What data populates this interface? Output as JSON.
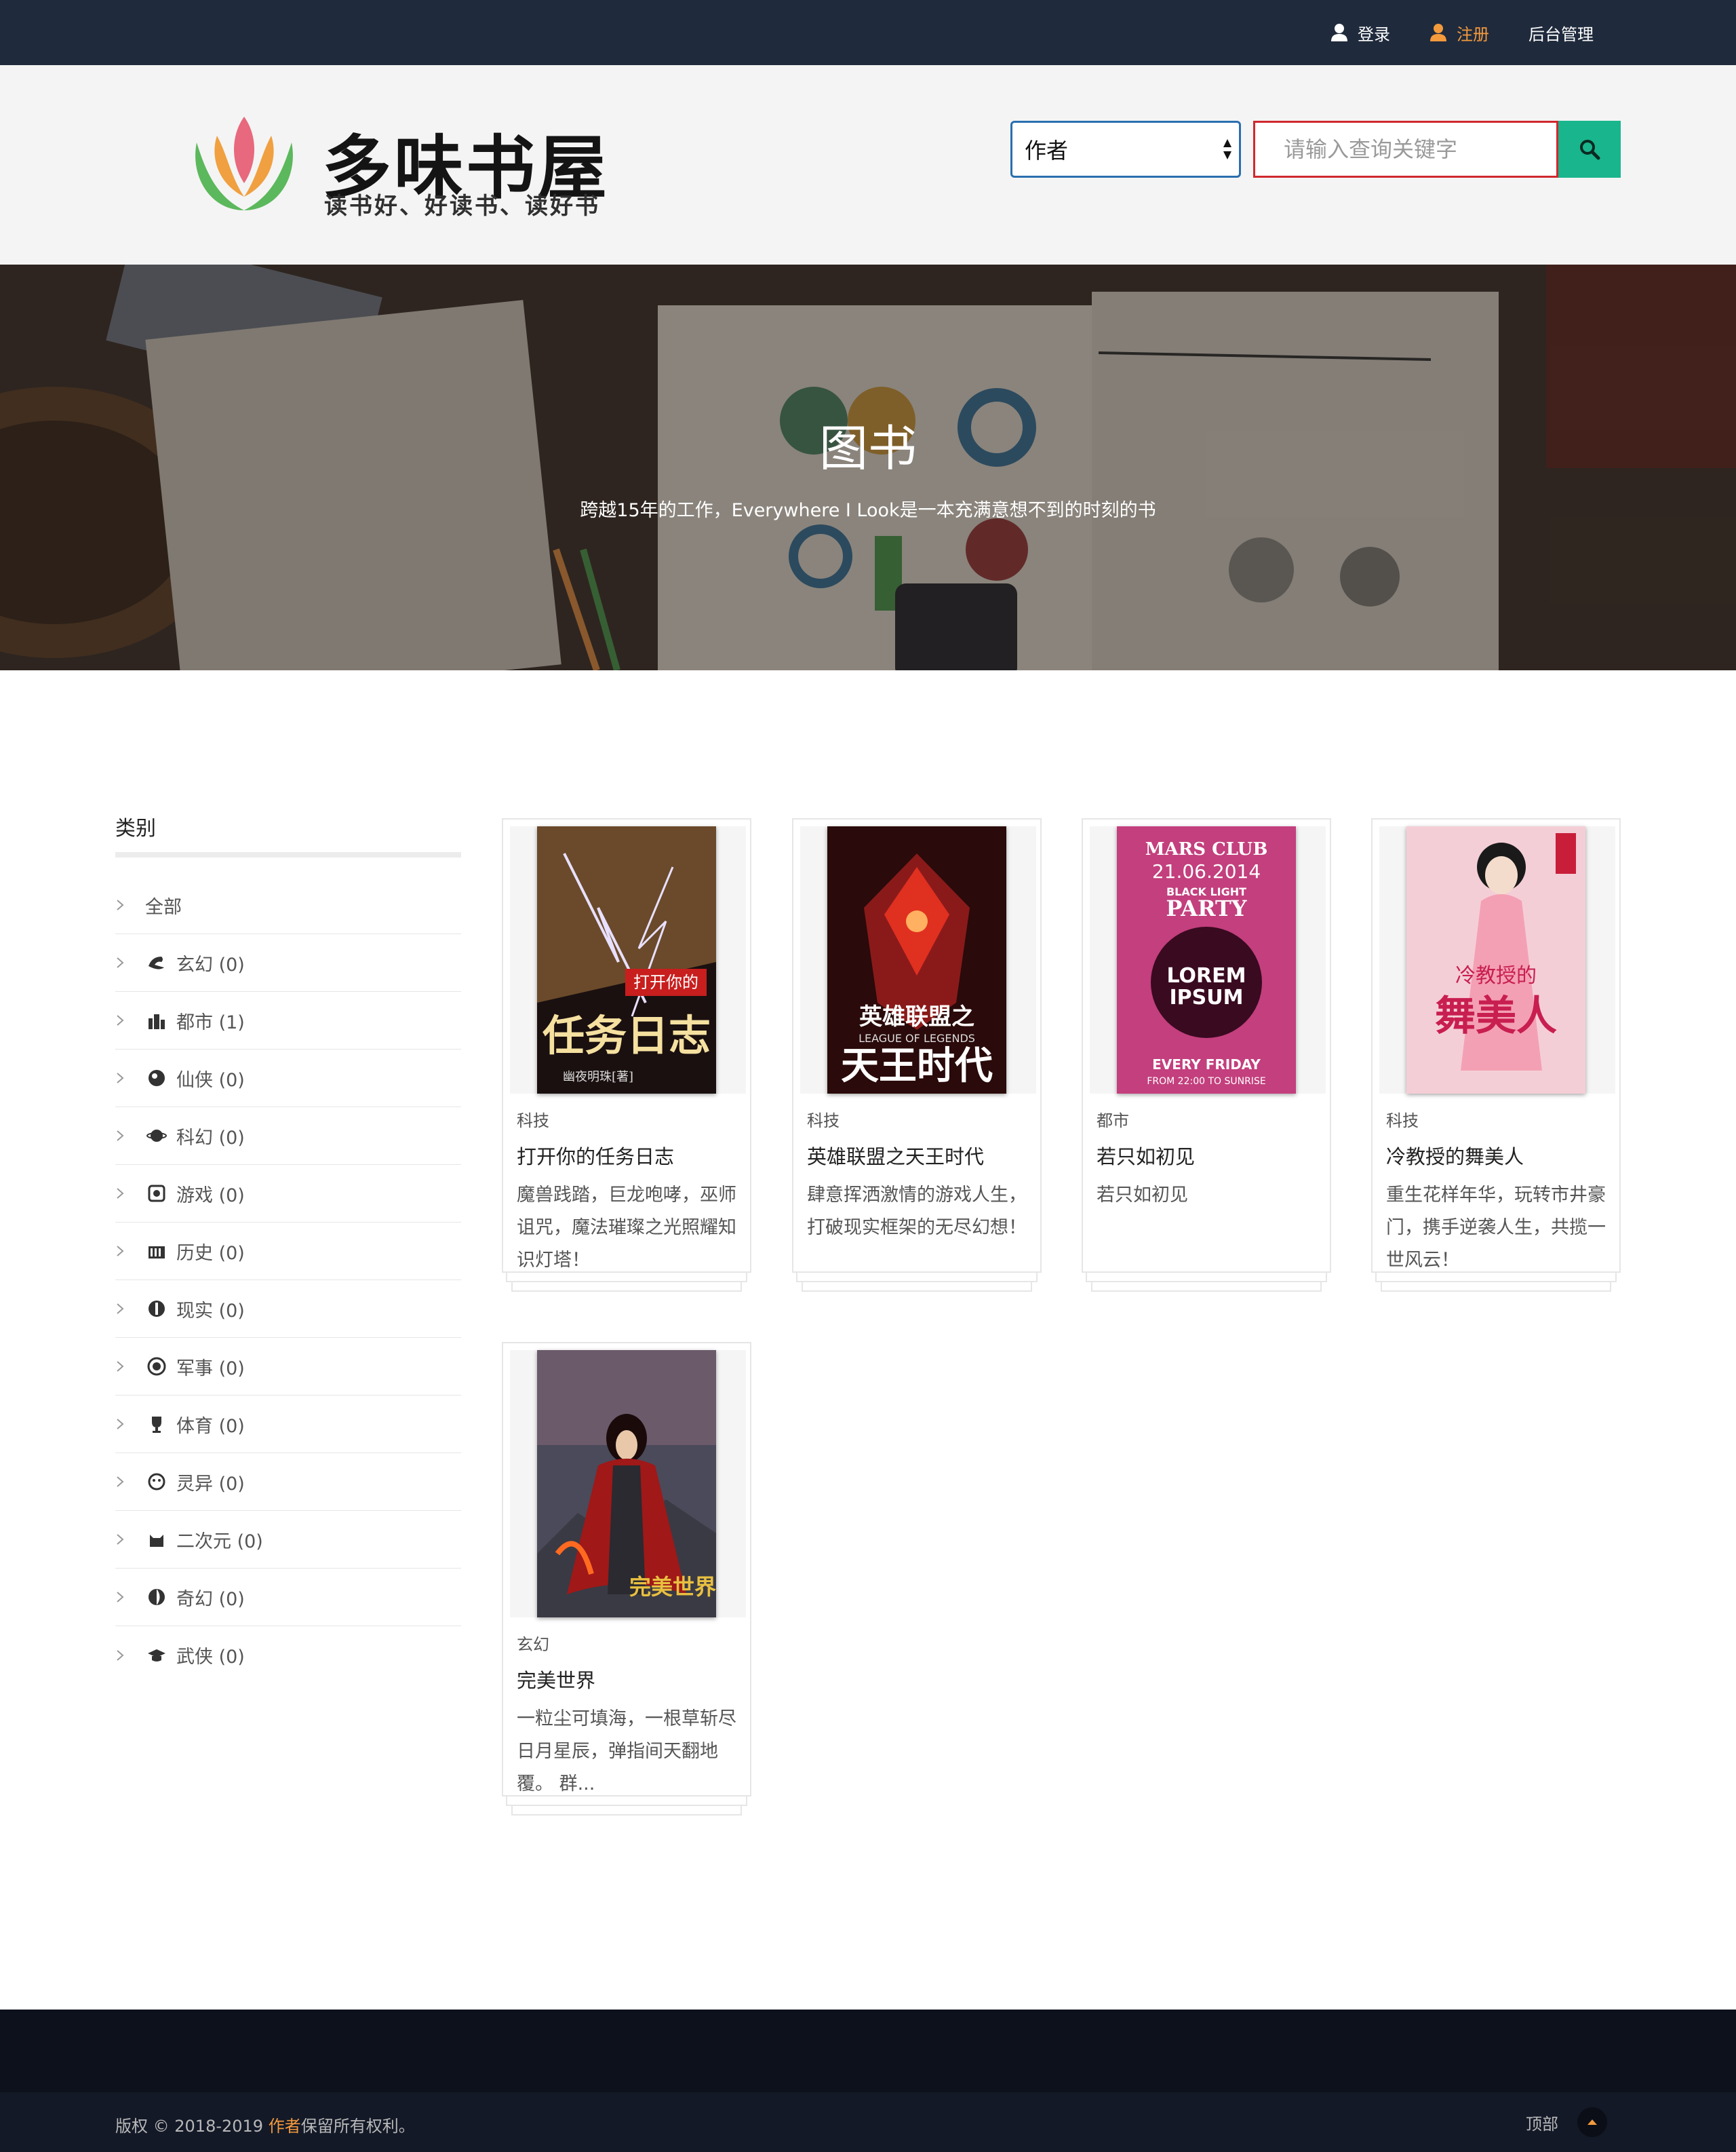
{
  "topnav": {
    "login": "登录",
    "register": "注册",
    "admin": "后台管理"
  },
  "logo": {
    "title": "多味书屋",
    "slogan": "读书好、好读书、读好书"
  },
  "search": {
    "select_value": "作者",
    "placeholder": "请输入查询关键字",
    "button_icon": "search-icon"
  },
  "hero": {
    "title": "图书",
    "subtitle": "跨越15年的工作，Everywhere I Look是一本充满意想不到的时刻的书"
  },
  "sidebar": {
    "title": "类别",
    "items": [
      {
        "label": "全部",
        "icon": ""
      },
      {
        "label": "玄幻 (0)",
        "icon": "dragon-icon"
      },
      {
        "label": "都市 (1)",
        "icon": "city-icon"
      },
      {
        "label": "仙侠 (0)",
        "icon": "immortal-icon"
      },
      {
        "label": "科幻 (0)",
        "icon": "planet-icon"
      },
      {
        "label": "游戏 (0)",
        "icon": "gamepad-icon"
      },
      {
        "label": "历史 (0)",
        "icon": "history-icon"
      },
      {
        "label": "现实 (0)",
        "icon": "reality-icon"
      },
      {
        "label": "军事 (0)",
        "icon": "military-icon"
      },
      {
        "label": "体育 (0)",
        "icon": "trophy-icon"
      },
      {
        "label": "灵异 (0)",
        "icon": "ghost-icon"
      },
      {
        "label": "二次元 (0)",
        "icon": "anime-cat-icon"
      },
      {
        "label": "奇幻 (0)",
        "icon": "fantasy-icon"
      },
      {
        "label": "武侠 (0)",
        "icon": "martial-icon"
      }
    ]
  },
  "books": [
    {
      "category": "科技",
      "title": "打开你的任务日志",
      "desc": "魔兽践踏，巨龙咆哮，巫师诅咒，魔法璀璨之光照耀知识灯塔！",
      "cover_text": "任务日志"
    },
    {
      "category": "科技",
      "title": "英雄联盟之天王时代",
      "desc": "肆意挥洒激情的游戏人生，打破现实框架的无尽幻想！",
      "cover_text": "天王时代"
    },
    {
      "category": "都市",
      "title": "若只如初见",
      "desc": "若只如初见",
      "cover_text": "LOREM IPSUM"
    },
    {
      "category": "科技",
      "title": "冷教授的舞美人",
      "desc": "重生花样年华，玩转市井豪门，携手逆袭人生，共揽一世风云！",
      "cover_text": "舞美人"
    },
    {
      "category": "玄幻",
      "title": "完美世界",
      "desc": "一粒尘可填海，一根草斩尽日月星辰，弹指间天翻地覆。 群...",
      "cover_text": "完美世界"
    }
  ],
  "footer": {
    "copyright_prefix": "版权 © 2018-2019 ",
    "author": "作者",
    "copyright_suffix": "保留所有权利。",
    "back_to_top": "顶部"
  },
  "colors": {
    "topbar": "#1f2a3c",
    "accent_orange": "#f39a3d",
    "search_button": "#19b58d",
    "search_border": "#d0282e",
    "select_border": "#2a6fb0"
  }
}
